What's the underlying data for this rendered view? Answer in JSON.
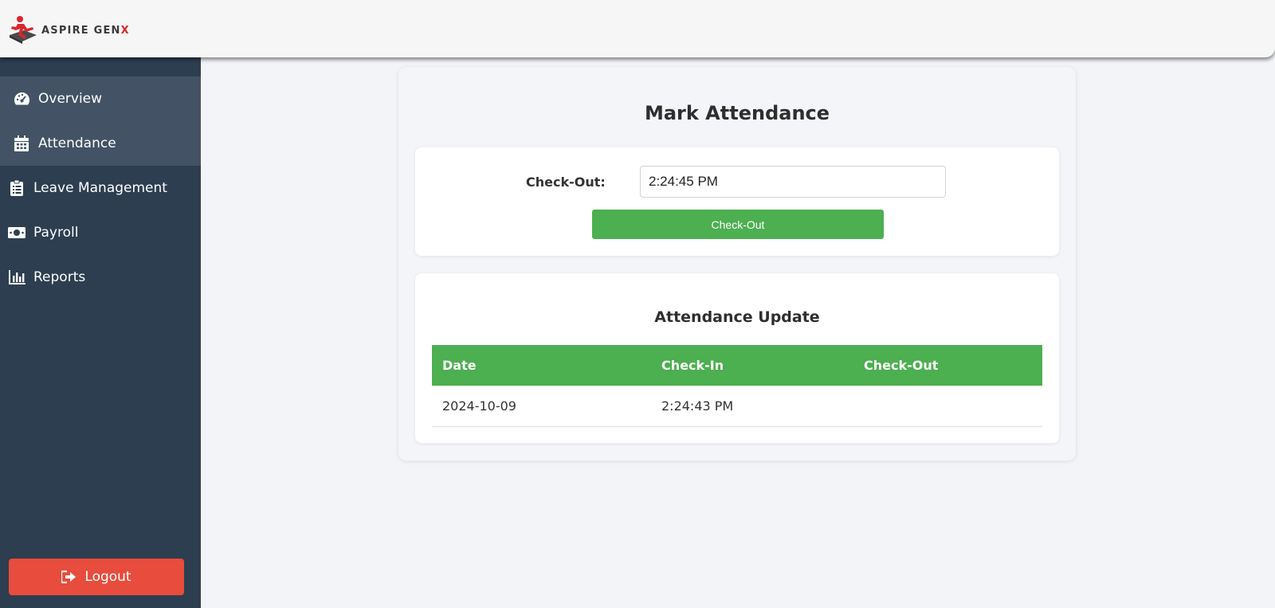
{
  "header": {
    "brand_prefix": "ASPIRE GEN",
    "brand_suffix": "X"
  },
  "sidebar": {
    "items": [
      {
        "label": "Overview",
        "icon": "gauge-icon"
      },
      {
        "label": "Attendance",
        "icon": "calendar-icon"
      },
      {
        "label": "Leave Management",
        "icon": "clipboard-icon"
      },
      {
        "label": "Payroll",
        "icon": "money-bill-icon"
      },
      {
        "label": "Reports",
        "icon": "bar-chart-icon"
      }
    ],
    "logout_label": "Logout"
  },
  "main": {
    "title": "Mark Attendance",
    "checkout": {
      "label": "Check-Out:",
      "value": "2:24:45 PM",
      "button_label": "Check-Out"
    },
    "update": {
      "title": "Attendance Update",
      "columns": [
        "Date",
        "Check-In",
        "Check-Out"
      ],
      "rows": [
        {
          "date": "2024-10-09",
          "check_in": "2:24:43 PM",
          "check_out": ""
        }
      ]
    }
  },
  "colors": {
    "sidebar_bg": "#2d3e50",
    "sidebar_highlight": "#435365",
    "accent_green": "#4caf50",
    "logout_red": "#e74c3c",
    "brand_red": "#d9262c"
  }
}
